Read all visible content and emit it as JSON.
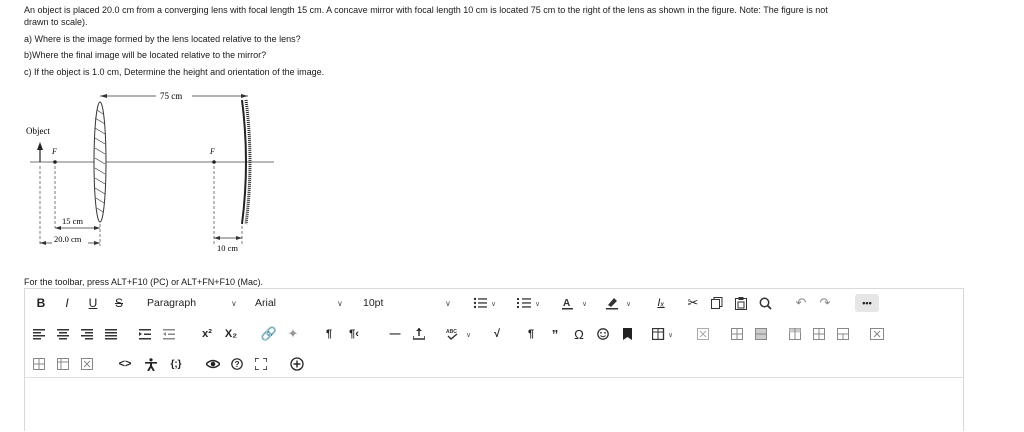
{
  "question": {
    "line1": "An object is placed 20.0 cm from a converging lens with focal length 15 cm.   A concave mirror with focal length 10 cm is located 75 cm to the right of the lens as shown in the figure.  Note: The figure is not",
    "line2": "drawn to scale).",
    "part_a": "a) Where is the image formed by the lens located relative to the lens?",
    "part_b": "b)Where the final image will be located relative to the mirror?",
    "part_c": "c) If the object is 1.0 cm, Determine the height and orientation of the image."
  },
  "figure": {
    "label_75": "75 cm",
    "label_object": "Object",
    "label_f_left": "F",
    "label_f_right": "F",
    "label_15": "15 cm",
    "label_20": "20.0 cm",
    "label_10": "10 cm"
  },
  "editor": {
    "hint": "For the toolbar, press ALT+F10 (PC) or ALT+FN+F10 (Mac).",
    "bold": "B",
    "italic": "I",
    "underline": "U",
    "strike": "S",
    "paragraph_label": "Paragraph",
    "font_label": "Arial",
    "size_label": "10pt",
    "more_label": "•••"
  },
  "icons": [
    "bold",
    "italic",
    "underline",
    "strikethrough",
    "paragraph-select",
    "font-select",
    "size-select",
    "bullet-list",
    "numbered-list",
    "text-color",
    "highlight",
    "clear-formatting",
    "cut",
    "copy",
    "paste",
    "find",
    "undo",
    "redo",
    "more",
    "align-left",
    "align-center",
    "align-right",
    "justify",
    "indent",
    "outdent",
    "superscript",
    "subscript",
    "link",
    "unlink",
    "ltr",
    "rtl",
    "horizontal-line",
    "anchor",
    "spellcheck",
    "sqrt",
    "pilcrow",
    "quote",
    "omega",
    "emoji",
    "bookmark",
    "table",
    "insert-image",
    "merge-cells",
    "split-cells",
    "insert-column",
    "insert-row",
    "delete-row",
    "delete-column",
    "delete-table",
    "code",
    "accessibility",
    "equation",
    "preview",
    "help",
    "fullscreen",
    "add"
  ]
}
